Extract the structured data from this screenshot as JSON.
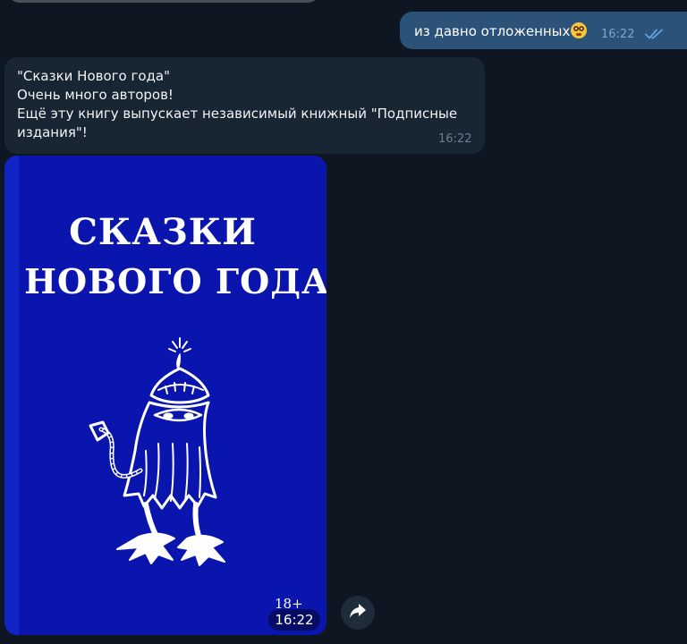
{
  "messages": {
    "outgoing": {
      "text": "из давно отложенных",
      "emoji": "flushed-face-emoji",
      "time": "16:22",
      "status_icon": "double-check-icon"
    },
    "incoming_text": {
      "lines": [
        "\"Сказки Нового года\"",
        "Очень много авторов!",
        "Ещё эту книгу выпускает независимый книжный \"Подписные",
        "издания\"!"
      ],
      "time": "16:22"
    },
    "incoming_photo": {
      "cover_title_line1": "Сказки",
      "cover_title_line2": "Нового года",
      "age_rating": "18+",
      "time": "16:22",
      "cover_color": "#0a15ad",
      "illustration": "ghost-creature-illustration"
    }
  },
  "actions": {
    "forward_icon": "forward-arrow-icon"
  },
  "colors": {
    "background": "#0e1621",
    "outgoing_bubble": "#2b5278",
    "incoming_bubble": "#182533",
    "check_color": "#63a2e0"
  }
}
